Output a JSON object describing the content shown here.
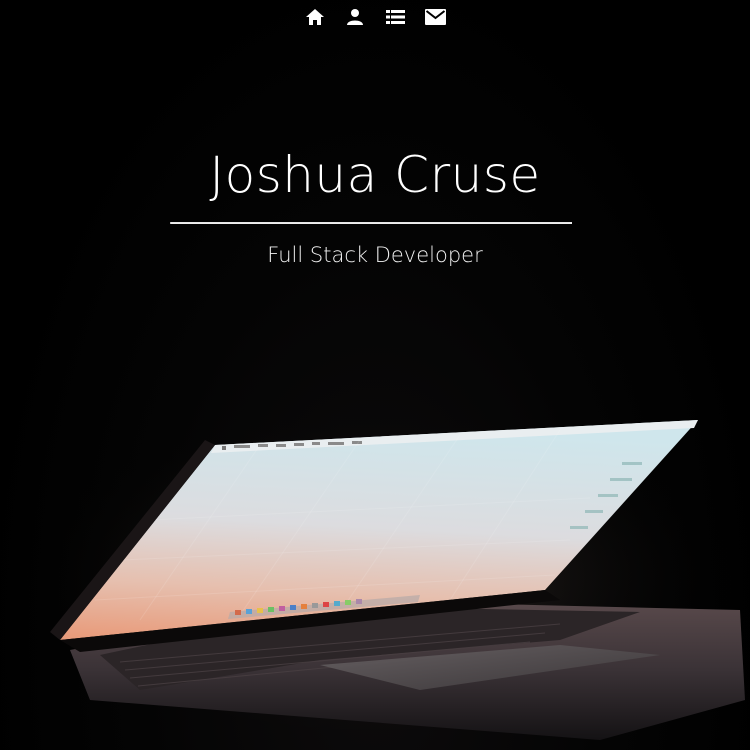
{
  "nav": {
    "items": [
      {
        "icon": "home-icon"
      },
      {
        "icon": "person-icon"
      },
      {
        "icon": "list-icon"
      },
      {
        "icon": "mail-icon"
      }
    ]
  },
  "hero": {
    "name": "Joshua Cruse",
    "subtitle": "Full Stack Developer",
    "background_image": "laptop-photo"
  },
  "colors": {
    "background": "#000000",
    "text": "#ffffff",
    "screen_top": "#cfe6ec",
    "screen_bottom": "#e8a483"
  }
}
